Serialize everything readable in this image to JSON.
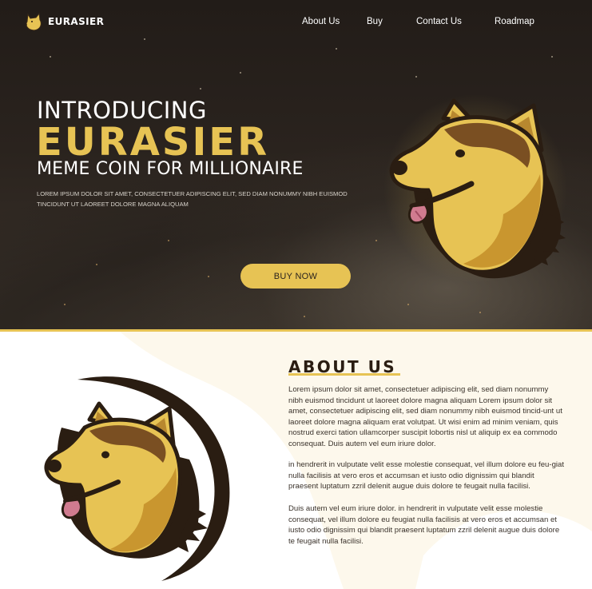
{
  "brand": {
    "name": "EURASIER"
  },
  "nav": {
    "items": [
      "About Us",
      "Buy",
      "Contact Us",
      "Roadmap"
    ]
  },
  "hero": {
    "intro": "INTRODUCING",
    "headline": "EURASIER",
    "subhead": "MEME COIN FOR MILLIONAIRE",
    "lorem": "Lorem ipsum dolor sit amet, consectetuer adipiscing elit, sed diam nonummy nibh euismod tincidunt ut laoreet dolore magna aliquam",
    "cta": "BUY NOW"
  },
  "about": {
    "title": "ABOUT US",
    "paragraphs": [
      "Lorem ipsum dolor sit amet, consectetuer adipiscing elit, sed diam nonummy nibh euismod tincidunt ut laoreet dolore magna aliquam Lorem ipsum dolor sit amet, consectetuer adipiscing elit, sed diam nonummy nibh euismod tincid-unt ut laoreet dolore magna aliquam erat volutpat. Ut wisi enim ad minim veniam, quis nostrud exerci tation ullamcorper suscipit lobortis nisl ut aliquip ex ea commodo consequat. Duis autem vel eum iriure dolor.",
      " in hendrerit in vulputate velit esse molestie consequat, vel illum dolore eu feu-giat nulla facilisis at vero eros et accumsan et iusto odio dignissim qui blandit praesent luptatum zzril delenit augue duis dolore te feugait nulla facilisi.",
      "Duis autem vel eum iriure dolor. in hendrerit in vulputate velit esse molestie consequat, vel illum dolore eu feugiat nulla facilisis at vero eros et accumsan et iusto odio dignissim qui blandit praesent luptatum zzril delenit augue duis dolore te feugait nulla facilisi."
    ]
  },
  "colors": {
    "accent": "#e7c354",
    "hero_bg": "#2a231e",
    "dark_brown": "#2a1d12",
    "cream": "#fdf8ec"
  },
  "icons": {
    "logo": "dog-head-icon"
  }
}
